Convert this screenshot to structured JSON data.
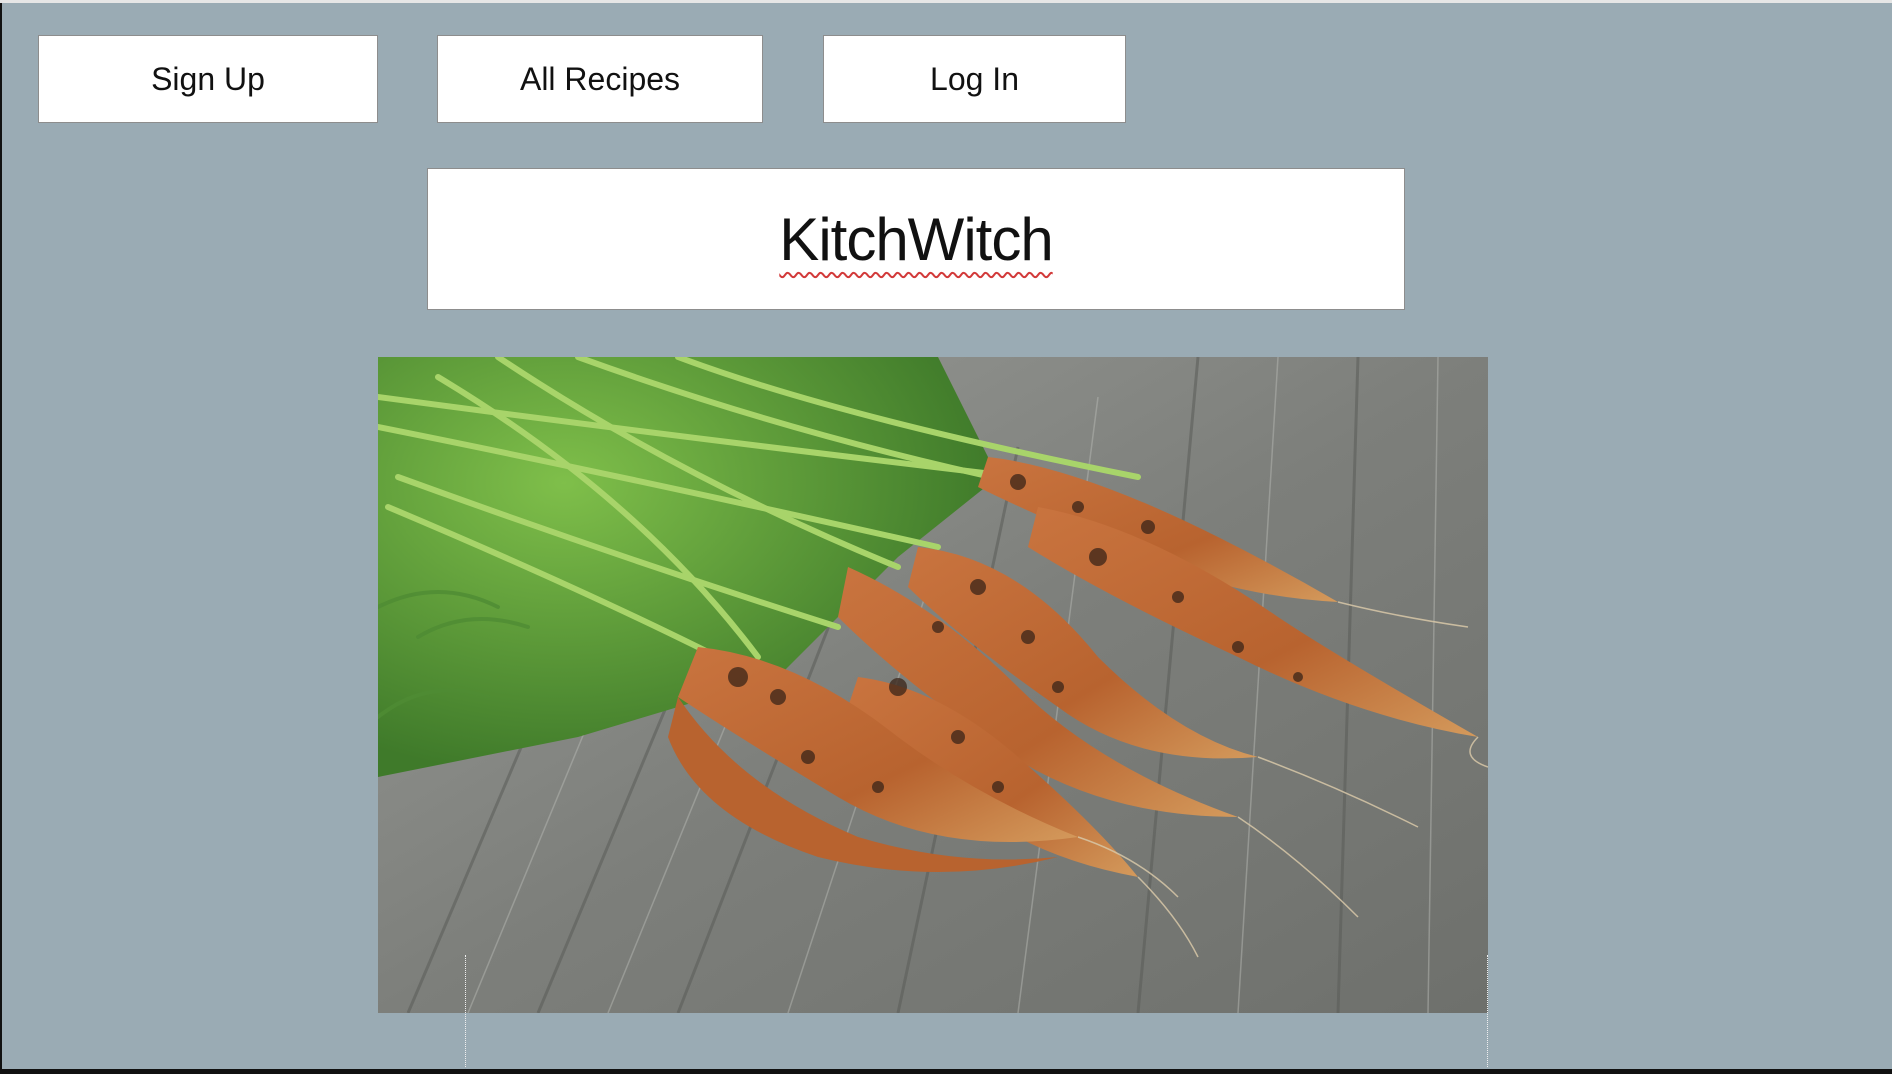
{
  "nav": {
    "sign_up_label": "Sign Up",
    "all_recipes_label": "All Recipes",
    "log_in_label": "Log In"
  },
  "header": {
    "title": "KitchWitch"
  },
  "hero_image": {
    "alt": "carrots"
  },
  "colors": {
    "background": "#9aabb4",
    "button_bg": "#ffffff",
    "button_border": "#8d8d8d",
    "text": "#111111"
  }
}
